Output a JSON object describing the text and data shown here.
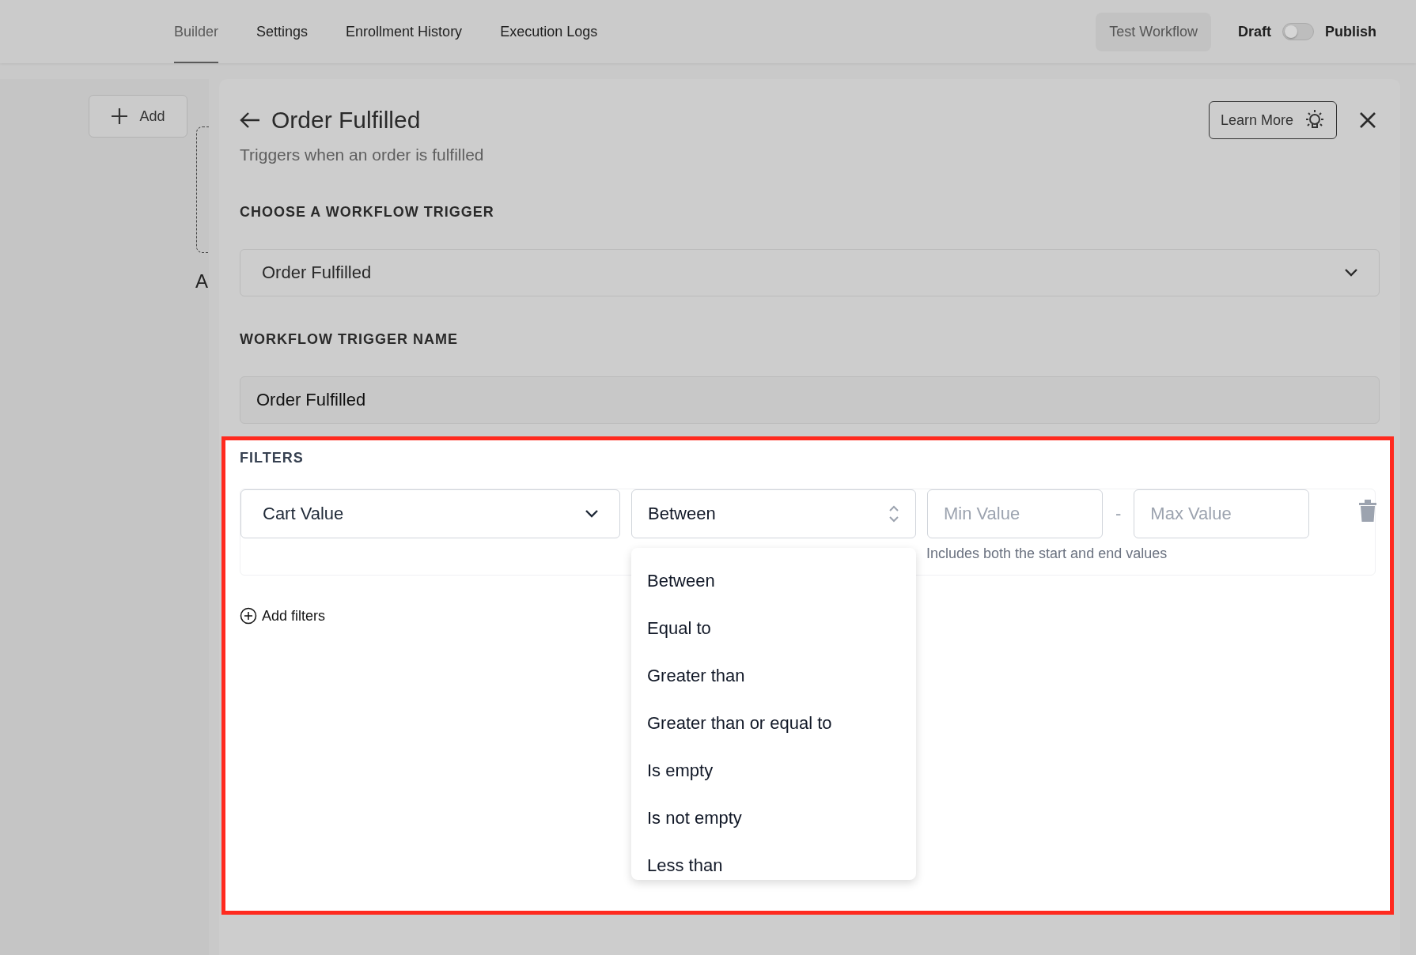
{
  "nav_tabs": [
    {
      "label": "Builder",
      "selected": true
    },
    {
      "label": "Settings",
      "selected": false
    },
    {
      "label": "Enrollment History",
      "selected": false
    },
    {
      "label": "Execution Logs",
      "selected": false
    }
  ],
  "header_actions": {
    "test_button": "Test Workflow",
    "draft_label": "Draft",
    "publish_toggle": {
      "on": false
    },
    "publish_label": "Publish"
  },
  "sidebar": {
    "add_button": "Add",
    "node_label": "A"
  },
  "trigger_panel": {
    "title": "Order Fulfilled",
    "subtitle": "Triggers when an order is fulfilled",
    "learn_more_button": "Learn More",
    "trigger_label": "CHOOSE A WORKFLOW TRIGGER",
    "trigger_select": {
      "value": "Order Fulfilled"
    },
    "name_label": "WORKFLOW TRIGGER NAME",
    "name_input": {
      "value": "Order Fulfilled"
    }
  },
  "filters": {
    "label": "FILTERS",
    "rows": [
      {
        "field": "Cart Value",
        "operator": "Between",
        "min": {
          "placeholder": "Min Value"
        },
        "separator": "-",
        "max": {
          "placeholder": "Max Value"
        },
        "hint": "Includes both the start and end values"
      }
    ],
    "add_button": "Add filters",
    "operator_menu": {
      "options": [
        "Between",
        "Equal to",
        "Greater than",
        "Greater than or equal to",
        "Is empty",
        "Is not empty",
        "Less than"
      ]
    }
  }
}
